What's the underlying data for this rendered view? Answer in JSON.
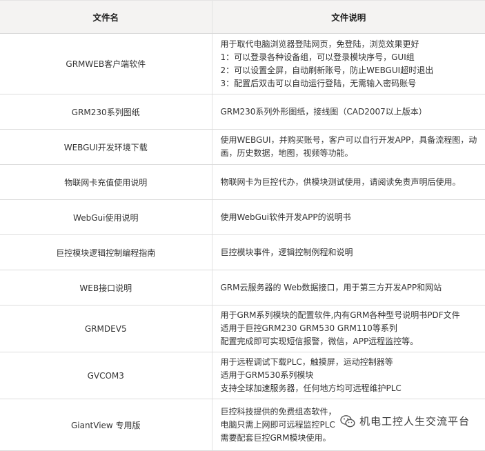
{
  "table": {
    "headers": [
      "文件名",
      "文件说明"
    ],
    "rows": [
      {
        "name": "GRMWEB客户端软件",
        "lines": [
          "用于取代电脑浏览器登陆网页，免登陆，浏览效果更好",
          "1：可以登录各种设备组，可以登录模块序号，GUI组",
          "2：可以设置全屏，自动刷新账号，防止WEBGUI超时退出",
          "3：配置后双击可以自动运行登陆，无需输入密码账号"
        ]
      },
      {
        "name": "GRM230系列图纸",
        "lines": [
          "GRM230系列外形图纸，接线图（CAD2007以上版本）"
        ]
      },
      {
        "name": "WEBGUI开发环境下载",
        "lines": [
          "使用WEBGUI，并购买账号，客户可以自行开发APP，具备流程图，动",
          "画，历史数据，地图，视频等功能。"
        ]
      },
      {
        "name": "物联网卡充值使用说明",
        "lines": [
          "物联网卡为巨控代办，供模块测试使用，请阅读免责声明后使用。"
        ]
      },
      {
        "name": "WebGui使用说明",
        "lines": [
          "使用WebGui软件开发APP的说明书"
        ]
      },
      {
        "name": "巨控模块逻辑控制编程指南",
        "lines": [
          "巨控模块事件，逻辑控制例程和说明"
        ]
      },
      {
        "name": "WEB接口说明",
        "lines": [
          "GRM云服务器的 Web数据接口，用于第三方开发APP和网站"
        ]
      },
      {
        "name": "GRMDEV5",
        "lines": [
          "用于GRM系列模块的配置软件,内有GRM各种型号说明书PDF文件",
          "适用于巨控GRM230 GRM530 GRM110等系列",
          "配置完成即可实现短信报警，微信，APP远程监控等。"
        ]
      },
      {
        "name": "GVCOM3",
        "lines": [
          "用于远程调试下载PLC，触摸屏，运动控制器等",
          "适用于GRM530系列模块",
          "支持全球加速服务器，任何地方均可远程维护PLC"
        ]
      },
      {
        "name": "GiantView 专用版",
        "lines": [
          "巨控科技提供的免费组态软件，",
          "电脑只需上网即可远程监控PLC",
          "需要配套巨控GRM模块使用。"
        ]
      }
    ]
  },
  "watermark": {
    "text": "机电工控人生交流平台",
    "icon": "wechat-icon"
  }
}
